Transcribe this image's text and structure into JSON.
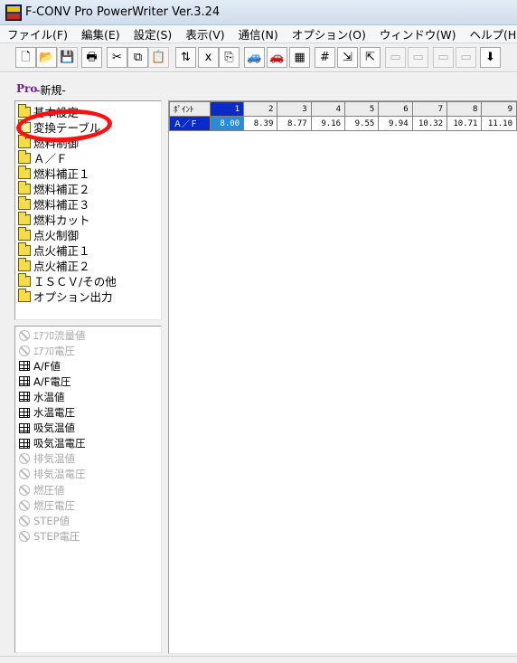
{
  "window": {
    "title": "F-CONV Pro PowerWriter Ver.3.24"
  },
  "menu": [
    "ファイル(F)",
    "編集(E)",
    "設定(S)",
    "表示(V)",
    "通信(N)",
    "オプション(O)",
    "ウィンドウ(W)",
    "ヘルプ(H)"
  ],
  "toolbar": {
    "buttons": [
      {
        "icon": "new-file-icon",
        "glyph": "🗋",
        "enabled": true
      },
      {
        "icon": "open-folder-icon",
        "glyph": "📂",
        "enabled": true
      },
      {
        "icon": "save-icon",
        "glyph": "💾",
        "enabled": false
      },
      {
        "icon": "print-icon",
        "glyph": "🖶",
        "enabled": true
      },
      {
        "icon": "cut-icon",
        "glyph": "✂",
        "enabled": true
      },
      {
        "icon": "copy-icon",
        "glyph": "⧉",
        "enabled": true
      },
      {
        "icon": "paste-icon",
        "glyph": "📋",
        "enabled": false
      },
      {
        "icon": "set-table-icon",
        "glyph": "⇅",
        "enabled": true
      },
      {
        "icon": "xk-calc-icon",
        "glyph": "ⅹ",
        "enabled": true
      },
      {
        "icon": "table-copy-icon",
        "glyph": "⎘",
        "enabled": true
      },
      {
        "icon": "car-blue-icon",
        "glyph": "🚙",
        "enabled": true
      },
      {
        "icon": "car-red-icon",
        "glyph": "🚗",
        "enabled": true
      },
      {
        "icon": "monitor-icon",
        "glyph": "▦",
        "enabled": true
      },
      {
        "icon": "grid-icon",
        "glyph": "#",
        "enabled": true
      },
      {
        "icon": "write-ecu-icon",
        "glyph": "⇲",
        "enabled": true
      },
      {
        "icon": "read-ecu-icon",
        "glyph": "⇱",
        "enabled": true
      },
      {
        "icon": "device-a-icon",
        "glyph": "▭",
        "enabled": false
      },
      {
        "icon": "device-b-icon",
        "glyph": "▭",
        "enabled": false
      },
      {
        "icon": "device-c-icon",
        "glyph": "▭",
        "enabled": false
      },
      {
        "icon": "device-d-icon",
        "glyph": "▭",
        "enabled": false
      },
      {
        "icon": "download-icon",
        "glyph": "⬇",
        "enabled": true
      }
    ]
  },
  "document": {
    "logo": "Pro",
    "title": "-新規-"
  },
  "tree": [
    {
      "label": "基本設定",
      "icon": "folder-icon"
    },
    {
      "label": "変換テーブル",
      "icon": "folder-open-icon"
    },
    {
      "label": "燃料制御",
      "icon": "folder-icon"
    },
    {
      "label": "Ａ／Ｆ",
      "icon": "folder-icon"
    },
    {
      "label": "燃料補正１",
      "icon": "folder-icon"
    },
    {
      "label": "燃料補正２",
      "icon": "folder-icon"
    },
    {
      "label": "燃料補正３",
      "icon": "folder-icon"
    },
    {
      "label": "燃料カット",
      "icon": "folder-icon"
    },
    {
      "label": "点火制御",
      "icon": "folder-icon"
    },
    {
      "label": "点火補正１",
      "icon": "folder-icon"
    },
    {
      "label": "点火補正２",
      "icon": "folder-icon"
    },
    {
      "label": "ＩＳＣＶ/その他",
      "icon": "folder-icon"
    },
    {
      "label": "オプション出力",
      "icon": "folder-icon"
    }
  ],
  "sensors": [
    {
      "label": "ｴｱﾌﾛ流量値",
      "enabled": false
    },
    {
      "label": "ｴｱﾌﾛ電圧",
      "enabled": false
    },
    {
      "label": "A/F値",
      "enabled": true
    },
    {
      "label": "A/F電圧",
      "enabled": true
    },
    {
      "label": "水温値",
      "enabled": true
    },
    {
      "label": "水温電圧",
      "enabled": true
    },
    {
      "label": "吸気温値",
      "enabled": true
    },
    {
      "label": "吸気温電圧",
      "enabled": true
    },
    {
      "label": "排気温値",
      "enabled": false
    },
    {
      "label": "排気温電圧",
      "enabled": false
    },
    {
      "label": "燃圧値",
      "enabled": false
    },
    {
      "label": "燃圧電圧",
      "enabled": false
    },
    {
      "label": "STEP値",
      "enabled": false
    },
    {
      "label": "STEP電圧",
      "enabled": false
    }
  ],
  "table": {
    "corner_label": "ﾎﾟｲﾝﾄ",
    "columns": [
      "1",
      "2",
      "3",
      "4",
      "5",
      "6",
      "7",
      "8",
      "9"
    ],
    "row_label": "Ａ／Ｆ",
    "values": [
      "8.00",
      "8.39",
      "8.77",
      "9.16",
      "9.55",
      "9.94",
      "10.32",
      "10.71",
      "11.10"
    ],
    "selected_column": 0
  }
}
